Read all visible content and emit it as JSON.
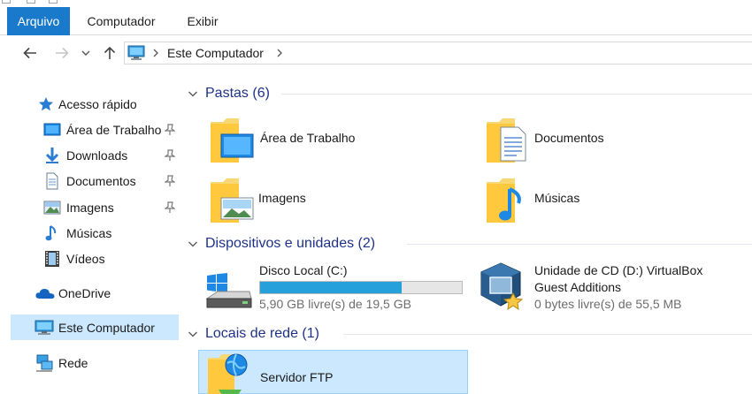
{
  "ribbon": {
    "file_tab": "Arquivo",
    "tabs": [
      "Computador",
      "Exibir"
    ]
  },
  "address": {
    "path": "Este Computador"
  },
  "sidebar": {
    "items": [
      {
        "label": "Acesso rápido",
        "icon": "star-icon"
      },
      {
        "label": "Área de Trabalho",
        "icon": "desktop-icon",
        "pinned": true
      },
      {
        "label": "Downloads",
        "icon": "download-arrow-icon",
        "pinned": true
      },
      {
        "label": "Documentos",
        "icon": "document-icon",
        "pinned": true
      },
      {
        "label": "Imagens",
        "icon": "image-icon",
        "pinned": true
      },
      {
        "label": "Músicas",
        "icon": "music-note-icon"
      },
      {
        "label": "Vídeos",
        "icon": "film-icon"
      },
      {
        "label": "OneDrive",
        "icon": "cloud-icon"
      },
      {
        "label": "Este Computador",
        "icon": "computer-icon",
        "selected": true
      },
      {
        "label": "Rede",
        "icon": "network-icon"
      }
    ]
  },
  "groups": {
    "folders": {
      "title": "Pastas (6)",
      "items": [
        "Área de Trabalho",
        "Documentos",
        "Imagens",
        "Músicas"
      ]
    },
    "devices": {
      "title": "Dispositivos e unidades (2)",
      "drives": [
        {
          "name": "Disco Local (C:)",
          "free": "5,90 GB livre(s) de 19,5 GB",
          "used_fraction": 0.7
        },
        {
          "name_line1": "Unidade de CD (D:) VirtualBox",
          "name_line2": "Guest Additions",
          "free": "0 bytes livre(s) de 55,5 MB"
        }
      ]
    },
    "network": {
      "title": "Locais de rede (1)",
      "items": [
        "Servidor FTP"
      ]
    }
  },
  "colors": {
    "accent": "#1979ca",
    "group_header": "#1e3287",
    "selection": "#cce8ff",
    "drive_bar": "#26a0da",
    "folder": "#f8d775"
  }
}
